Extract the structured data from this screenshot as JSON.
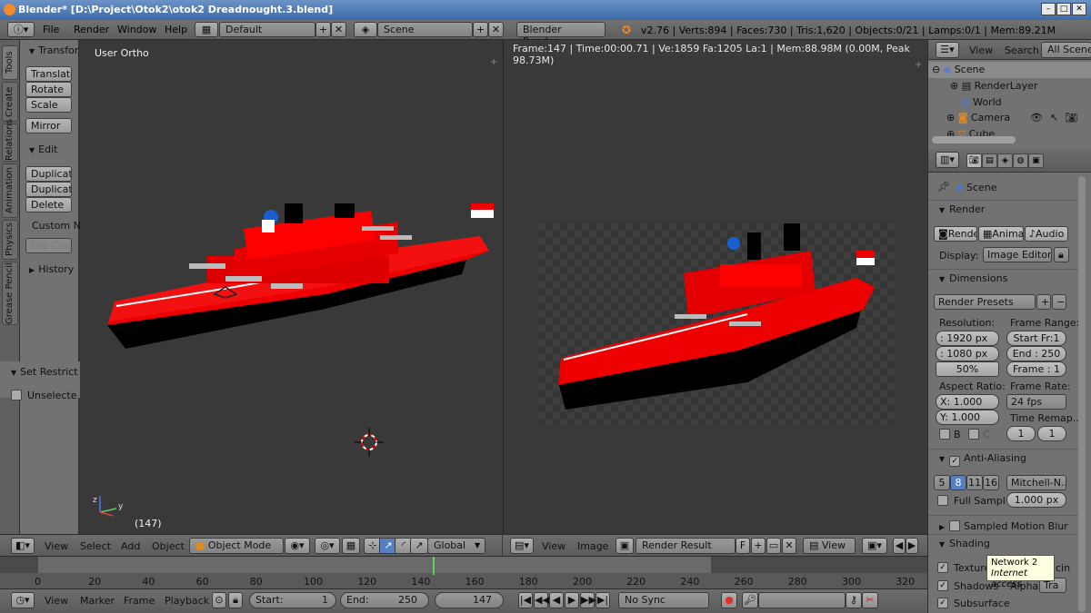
{
  "window": {
    "title": "Blender* [D:\\Project\\Otok2\\otok2 Dreadnought.3.blend]"
  },
  "topbar": {
    "menus": [
      "File",
      "Render",
      "Window",
      "Help"
    ],
    "screen_layout": "Default",
    "scene": "Scene",
    "render_engine": "Blender Render",
    "stats": "v2.76 | Verts:894 | Faces:730 | Tris:1,620 | Objects:0/21 | Lamps:0/1 | Mem:89.21M"
  },
  "tool_tabs": [
    "Tools",
    "Create",
    "Relations",
    "Animation",
    "Physics",
    "Grease Pencil"
  ],
  "tool_shelf": {
    "transform_header": "Transfor",
    "transform_buttons": [
      "Translate",
      "Rotate",
      "Scale"
    ],
    "mirror": "Mirror",
    "edit_header": "Edit",
    "edit_buttons": [
      "Duplicate",
      "Duplicate",
      "Delete"
    ],
    "custom": "Custom N",
    "flip_cust": "Flip Cust",
    "history_header": "History",
    "set_restrict": "Set Restrict",
    "unselected": "Unselecte"
  },
  "viewport": {
    "view_label": "User Ortho",
    "frame_label": "(147)",
    "header": {
      "view": "View",
      "select": "Select",
      "add": "Add",
      "object": "Object",
      "mode": "Object Mode",
      "orientation": "Global"
    }
  },
  "image_editor": {
    "stats": "Frame:147 | Time:00:00.71 | Ve:1859 Fa:1205 La:1 | Mem:88.98M (0.00M, Peak 98.73M)",
    "header": {
      "view": "View",
      "image": "Image",
      "image_name": "Render Result",
      "f_label": "F",
      "view_btn": "View"
    }
  },
  "timeline": {
    "ticks": [
      "0",
      "20",
      "40",
      "60",
      "80",
      "100",
      "120",
      "140",
      "160",
      "180",
      "200",
      "220",
      "240",
      "260",
      "280",
      "300",
      "320"
    ],
    "current_frame": 147,
    "header": {
      "view": "View",
      "marker": "Marker",
      "frame": "Frame",
      "playback": "Playback",
      "start_label": "Start:",
      "start": "1",
      "end_label": "End:",
      "end": "250",
      "current": "147",
      "sync": "No Sync"
    }
  },
  "outliner": {
    "view": "View",
    "search": "Search",
    "filter": "All Scenes",
    "rows": [
      "Scene",
      "RenderLayer",
      "World",
      "Camera",
      "Cube"
    ]
  },
  "properties": {
    "scene_path": "Scene",
    "render": {
      "header": "Render",
      "buttons": [
        "Render",
        "Animat",
        "Audio"
      ],
      "display_label": "Display:",
      "display_value": "Image Editor"
    },
    "dimensions": {
      "header": "Dimensions",
      "presets": "Render Presets",
      "resolution_label": "Resolution:",
      "res_x": ": 1920 px",
      "res_y": ": 1080 px",
      "res_pct": "50%",
      "frame_range_label": "Frame Range:",
      "start_fr": "Start Fr:1",
      "end_fr": "End : 250",
      "frame": "Frame : 1",
      "aspect_label": "Aspect Ratio:",
      "aspect_x": "X:  1.000",
      "aspect_y": "Y:  1.000",
      "frame_rate_label": "Frame Rate:",
      "fps": "24 fps",
      "time_remap_label": "Time Remap...",
      "remap_old": "1",
      "remap_new": "1",
      "border": "B",
      "crop": "C"
    },
    "anti_aliasing": {
      "header": "Anti-Aliasing",
      "samples": [
        "5",
        "8",
        "11",
        "16"
      ],
      "selected_sample": "8",
      "filter": "Mitchell-N...",
      "full_sample": "Full Sampl",
      "filter_size": "1.000 px"
    },
    "sampled_motion_blur": "Sampled Motion Blur",
    "shading": {
      "header": "Shading",
      "textures": "Textures",
      "shadows": "Shadows",
      "subsurface": "Subsurface",
      "alpha_label": "Alpha",
      "alpha_value": "Tra",
      "cin": "cin"
    },
    "tooltip": {
      "line1": "Network  2",
      "line2": "Internet access"
    }
  },
  "colors": {
    "accent": "#5680c2",
    "ship_red": "#ee0000",
    "frame_marker": "#5fd35f"
  }
}
